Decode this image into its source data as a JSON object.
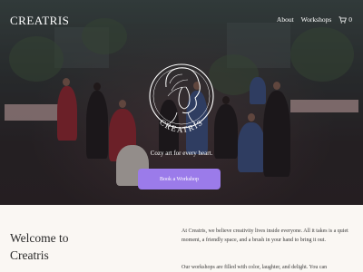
{
  "header": {
    "brand": "CREATRIS",
    "nav": [
      "About",
      "Workshops"
    ],
    "cart_count": "0"
  },
  "hero": {
    "logo_text": "CREATRIS",
    "tagline": "Cozy art for every heart.",
    "cta_label": "Book a Workshop"
  },
  "welcome": {
    "title_line1": "Welcome to",
    "title_line2": "Creatris",
    "paragraph1": "At Creatris, we believe creativity lives inside everyone. All it takes is a quiet moment, a friendly space, and a brush in your hand to bring it out.",
    "paragraph2": "Our workshops are filled with color, laughter, and delight. You can"
  },
  "colors": {
    "cta": "#9b7bea",
    "page_bg": "#faf7f3"
  }
}
